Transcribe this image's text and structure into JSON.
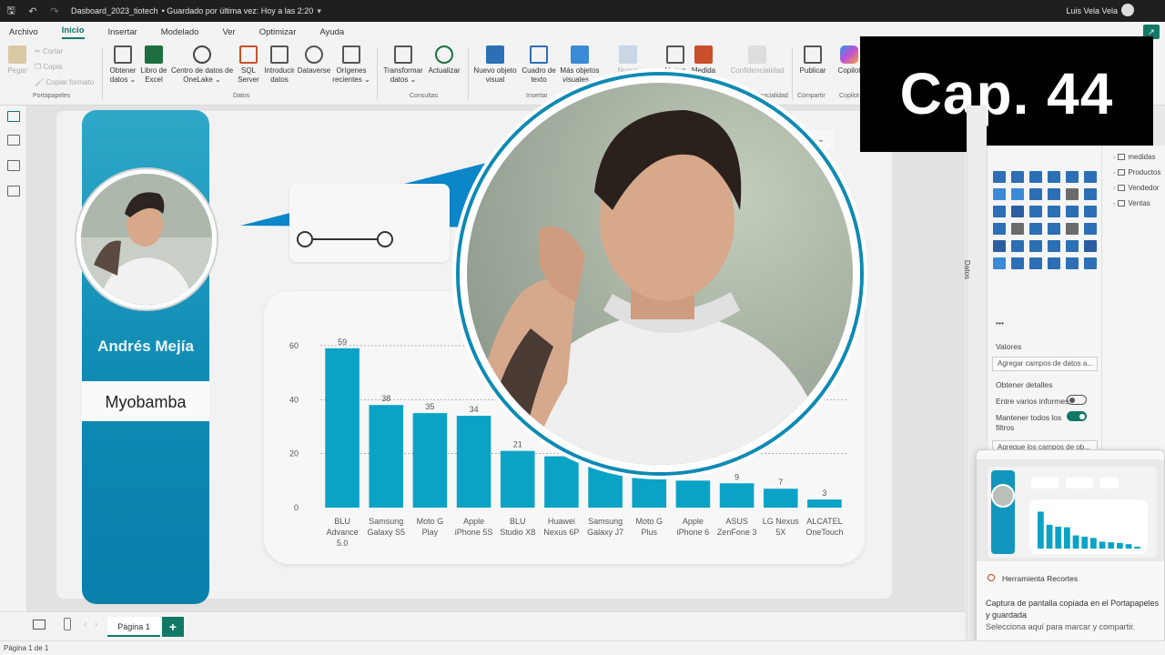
{
  "titlebar": {
    "document": "Dasboard_2023_tiotech",
    "saved_status": "• Guardado por última vez: Hoy a las 2:20",
    "user": "Luis Vela Vela"
  },
  "menu": [
    "Archivo",
    "Inicio",
    "Insertar",
    "Modelado",
    "Ver",
    "Optimizar",
    "Ayuda"
  ],
  "ribbon": {
    "clipboard": {
      "paste": "Pegar",
      "cut": "Cortar",
      "copy": "Copia",
      "format_painter": "Copiar formato",
      "group": "Portapapeles"
    },
    "data": {
      "get_data": "Obtener datos ⌄",
      "excel": "Libro de Excel",
      "onelake": "Centro de datos de OneLake ⌄",
      "sql": "SQL Server",
      "enter_data": "Introducir datos",
      "dataverse": "Dataverse",
      "recent": "Orígenes recientes ⌄",
      "group": "Datos"
    },
    "queries": {
      "transform": "Transformar datos ⌄",
      "refresh": "Actualizar",
      "group": "Consultas"
    },
    "insert": {
      "new_visual": "Nuevo objeto visual",
      "textbox": "Cuadro de texto",
      "more_visuals": "Más objetos visuales ⌄",
      "group": "Insertar"
    },
    "calc": {
      "new_measure": "Nueva medida",
      "quick_measure": "Nueva",
      "measure": "Medida"
    },
    "sensitivity": {
      "label": "Confidencialidad",
      "group": "Confidencialidad"
    },
    "share": {
      "publish": "Publicar",
      "group": "Compartir"
    },
    "copilot": {
      "label": "Copilot",
      "group": "Copilot"
    }
  },
  "badge": "Cap. 44",
  "profile": {
    "name": "Andrés Mejía",
    "city": "Myobamba"
  },
  "chart_data": {
    "type": "bar",
    "categories": [
      "BLU Advance 5.0",
      "Samsung Galaxy S5",
      "Moto G Play",
      "Apple iPhone 5S",
      "BLU Studio X8",
      "Huawei Nexus 6P",
      "Samsung Galaxy J7",
      "Moto G Plus",
      "Apple iPhone 6",
      "ASUS ZenFone 3",
      "LG Nexus 5X",
      "ALCATEL OneTouch"
    ],
    "values": [
      59,
      38,
      35,
      34,
      21,
      19,
      17,
      11,
      10,
      9,
      7,
      3
    ],
    "labels": [
      "59",
      "38",
      "35",
      "34",
      "21",
      "19",
      "",
      "",
      "",
      "9",
      "7",
      "3"
    ],
    "yticks": [
      0,
      20,
      40,
      60
    ],
    "ylim": [
      0,
      64
    ],
    "color": "#0aa3c6",
    "grid": true
  },
  "right_panel": {
    "vertical_title": "Datos",
    "tables": [
      "medidas",
      "Productos",
      "Vendedor",
      "Ventas"
    ],
    "values_label": "Valores",
    "add_fields": "Agregar campos de datos a...",
    "drillthrough": "Obtener detalles",
    "cross_report": "Entre varios informes",
    "keep_filters": "Mantener todos los filtros",
    "add_drill": "Agregue los campos de ob..."
  },
  "notification": {
    "app": "Herramienta Recortes",
    "message": "Captura de pantalla copiada en el Portapapeles y guardada",
    "action": "Selecciona aquí para marcar y compartir."
  },
  "pages": {
    "tab": "Página 1",
    "status": "Página 1 de 1"
  },
  "colors": {
    "accent": "#117865",
    "brand_blue": "#0e8ab3",
    "bar": "#0aa3c6"
  }
}
